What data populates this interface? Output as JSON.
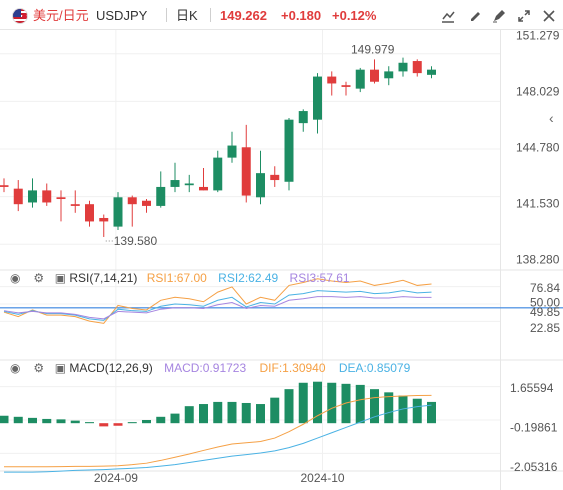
{
  "header": {
    "pair": "美元/日元",
    "symbol": "USDJPY",
    "interval": "日K",
    "price": "149.262",
    "change": "+0.180",
    "change_pct": "+0.12%",
    "up_color": "#e03c3c",
    "toolbar_icons": [
      "trend-line-icon",
      "draw-tool-icon",
      "pen-tool-icon",
      "fullscreen-icon",
      "close-icon"
    ]
  },
  "price_axis": {
    "ticks": [
      "151.279",
      "148.029",
      "144.780",
      "141.530",
      "138.280"
    ],
    "max_label": "149.979",
    "min_label": "139.580"
  },
  "rsi": {
    "title": "RSI(7,14,21)",
    "rsi1": "RSI1:67.00",
    "rsi2": "RSI2:62.49",
    "rsi3": "RSI3:57.61",
    "ticks": [
      "76.84",
      "50.00",
      "49.85",
      "22.85"
    ],
    "colors": [
      "#f5a045",
      "#4ab2e4",
      "#a685e0"
    ]
  },
  "macd": {
    "title": "MACD(12,26,9)",
    "macd": "MACD:0.91723",
    "dif": "DIF:1.30940",
    "dea": "DEA:0.85079",
    "ticks": [
      "1.65594",
      "-0.19861",
      "-2.05316"
    ],
    "colors": {
      "dif": "#f5a045",
      "dea": "#4ab2e4",
      "up": "#1d8d63",
      "down": "#e03c3c"
    }
  },
  "time_axis": [
    "2024-09",
    "2024-10"
  ],
  "chart_data": {
    "type": "candlestick",
    "candles": [
      {
        "o": 142.6,
        "h": 143.0,
        "l": 142.2,
        "c": 142.5
      },
      {
        "o": 142.4,
        "h": 142.9,
        "l": 141.1,
        "c": 141.5
      },
      {
        "o": 141.6,
        "h": 143.0,
        "l": 141.3,
        "c": 142.3
      },
      {
        "o": 142.3,
        "h": 142.7,
        "l": 141.4,
        "c": 141.6
      },
      {
        "o": 141.9,
        "h": 142.3,
        "l": 140.5,
        "c": 141.8
      },
      {
        "o": 141.5,
        "h": 142.3,
        "l": 141.0,
        "c": 141.4
      },
      {
        "o": 141.5,
        "h": 141.7,
        "l": 140.2,
        "c": 140.5
      },
      {
        "o": 140.7,
        "h": 140.9,
        "l": 139.6,
        "c": 140.5
      },
      {
        "o": 140.2,
        "h": 142.2,
        "l": 140.0,
        "c": 141.9
      },
      {
        "o": 141.9,
        "h": 142.0,
        "l": 140.2,
        "c": 141.5
      },
      {
        "o": 141.7,
        "h": 141.8,
        "l": 141.0,
        "c": 141.4
      },
      {
        "o": 141.4,
        "h": 143.4,
        "l": 141.3,
        "c": 142.5
      },
      {
        "o": 142.5,
        "h": 143.9,
        "l": 142.2,
        "c": 142.9
      },
      {
        "o": 142.6,
        "h": 143.2,
        "l": 142.2,
        "c": 142.7
      },
      {
        "o": 142.5,
        "h": 143.6,
        "l": 142.3,
        "c": 142.3
      },
      {
        "o": 142.3,
        "h": 144.6,
        "l": 142.2,
        "c": 144.2
      },
      {
        "o": 144.2,
        "h": 145.7,
        "l": 143.9,
        "c": 144.9
      },
      {
        "o": 144.8,
        "h": 146.1,
        "l": 141.6,
        "c": 142.0
      },
      {
        "o": 141.9,
        "h": 144.6,
        "l": 141.5,
        "c": 143.3
      },
      {
        "o": 143.2,
        "h": 143.7,
        "l": 142.5,
        "c": 142.9
      },
      {
        "o": 142.8,
        "h": 146.5,
        "l": 142.3,
        "c": 146.4
      },
      {
        "o": 146.2,
        "h": 147.0,
        "l": 145.7,
        "c": 146.9
      },
      {
        "o": 146.4,
        "h": 149.1,
        "l": 145.6,
        "c": 148.9
      },
      {
        "o": 148.9,
        "h": 149.2,
        "l": 147.8,
        "c": 148.5
      },
      {
        "o": 148.4,
        "h": 148.6,
        "l": 147.8,
        "c": 148.3
      },
      {
        "o": 148.2,
        "h": 149.4,
        "l": 148.0,
        "c": 149.3
      },
      {
        "o": 149.3,
        "h": 149.9,
        "l": 148.5,
        "c": 148.6
      },
      {
        "o": 148.8,
        "h": 149.5,
        "l": 148.4,
        "c": 149.2
      },
      {
        "o": 149.2,
        "h": 150.0,
        "l": 148.9,
        "c": 149.7
      },
      {
        "o": 149.8,
        "h": 149.9,
        "l": 148.9,
        "c": 149.1
      },
      {
        "o": 149.0,
        "h": 149.5,
        "l": 148.8,
        "c": 149.3
      }
    ],
    "price_range": [
      137.8,
      151.6
    ],
    "rsi_range": [
      20.0,
      90.0
    ],
    "rsi1": [
      44,
      38,
      47,
      40,
      40,
      38,
      32,
      29,
      53,
      49,
      47,
      60,
      64,
      62,
      58,
      71,
      78,
      55,
      64,
      60,
      80,
      84,
      89,
      86,
      84,
      86,
      80,
      83,
      87,
      80,
      82
    ],
    "rsi2": [
      45,
      41,
      46,
      42,
      42,
      40,
      35,
      33,
      48,
      46,
      45,
      52,
      55,
      54,
      52,
      60,
      64,
      51,
      57,
      55,
      67,
      69,
      73,
      72,
      71,
      72,
      69,
      70,
      73,
      70,
      71
    ],
    "rsi3": [
      46,
      43,
      45,
      43,
      43,
      41,
      37,
      35,
      45,
      44,
      43,
      48,
      50,
      50,
      49,
      54,
      57,
      49,
      53,
      52,
      60,
      62,
      65,
      65,
      64,
      65,
      63,
      63,
      65,
      64,
      64
    ],
    "macd_range": [
      -2.2,
      2.5
    ],
    "macd_hist": [
      0.35,
      0.3,
      0.25,
      0.2,
      0.18,
      0.12,
      0.05,
      -0.15,
      -0.12,
      0.05,
      0.15,
      0.3,
      0.45,
      0.8,
      0.9,
      1.0,
      1.0,
      0.95,
      0.9,
      1.2,
      1.6,
      1.9,
      1.95,
      1.9,
      1.85,
      1.8,
      1.6,
      1.45,
      1.3,
      1.15,
      1.0
    ],
    "dif": [
      -2.05,
      -2.05,
      -2.05,
      -2.05,
      -2.04,
      -2.03,
      -2.03,
      -2.02,
      -2.0,
      -1.95,
      -1.88,
      -1.75,
      -1.6,
      -1.45,
      -1.28,
      -1.12,
      -0.98,
      -0.92,
      -0.86,
      -0.7,
      -0.4,
      -0.05,
      0.35,
      0.7,
      0.95,
      1.1,
      1.2,
      1.25,
      1.28,
      1.3,
      1.31
    ],
    "dea": [
      -2.3,
      -2.3,
      -2.3,
      -2.28,
      -2.25,
      -2.22,
      -2.2,
      -2.18,
      -2.15,
      -2.12,
      -2.08,
      -2.02,
      -1.95,
      -1.85,
      -1.75,
      -1.65,
      -1.55,
      -1.48,
      -1.4,
      -1.3,
      -1.15,
      -0.95,
      -0.7,
      -0.45,
      -0.2,
      0.05,
      0.3,
      0.5,
      0.67,
      0.78,
      0.85
    ],
    "rsi_ref_lines": [
      50.0,
      49.85
    ],
    "time_ticks": [
      {
        "label": "2024-09",
        "index": 7.5
      },
      {
        "label": "2024-10",
        "index": 22
      }
    ]
  }
}
